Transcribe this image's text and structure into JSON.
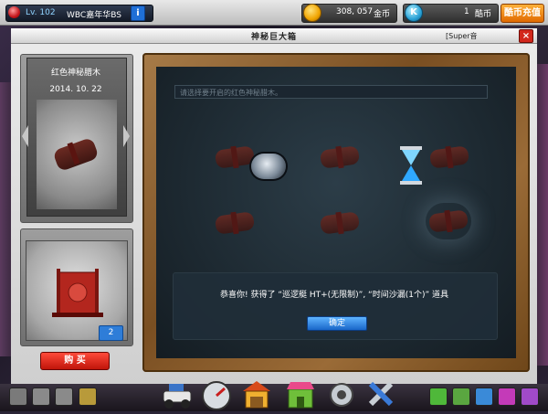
{
  "topbar": {
    "level": "Lv. 102",
    "nickname": "WBC嘉年华BS",
    "info_icon": "i",
    "coins_value": "308, 057",
    "coins_label": "金币",
    "k_icon": "K",
    "k_value": "1",
    "k_label": "酷币",
    "recharge_label": "酷币充值"
  },
  "window": {
    "title": "神秘巨大箱",
    "super_tag": "[Super音",
    "close_label": "×"
  },
  "item": {
    "name": "红色神秘腊木",
    "date": "2014. 10. 22",
    "count": "2",
    "buy_label": "购  买"
  },
  "board": {
    "hint_placeholder": "请选择要开启的红色神秘腊木。",
    "slots": [
      "log",
      "car",
      "log",
      "hourglass",
      "log",
      "log",
      "log",
      "log"
    ],
    "dialog_text": "恭喜你! 获得了 “巡逻艇 HT+(无限制)”, “时间沙漏(1个)” 道具",
    "ok_label": "确定"
  },
  "icons": {
    "prev": "arrow-left-icon",
    "next": "arrow-right-icon",
    "coin": "gold-coin-icon",
    "k": "k-coin-icon"
  },
  "colors": {
    "accent_orange": "#e06a00",
    "buy_red": "#c0150a",
    "ok_blue": "#1966c8",
    "board_dark": "#1d2931"
  }
}
